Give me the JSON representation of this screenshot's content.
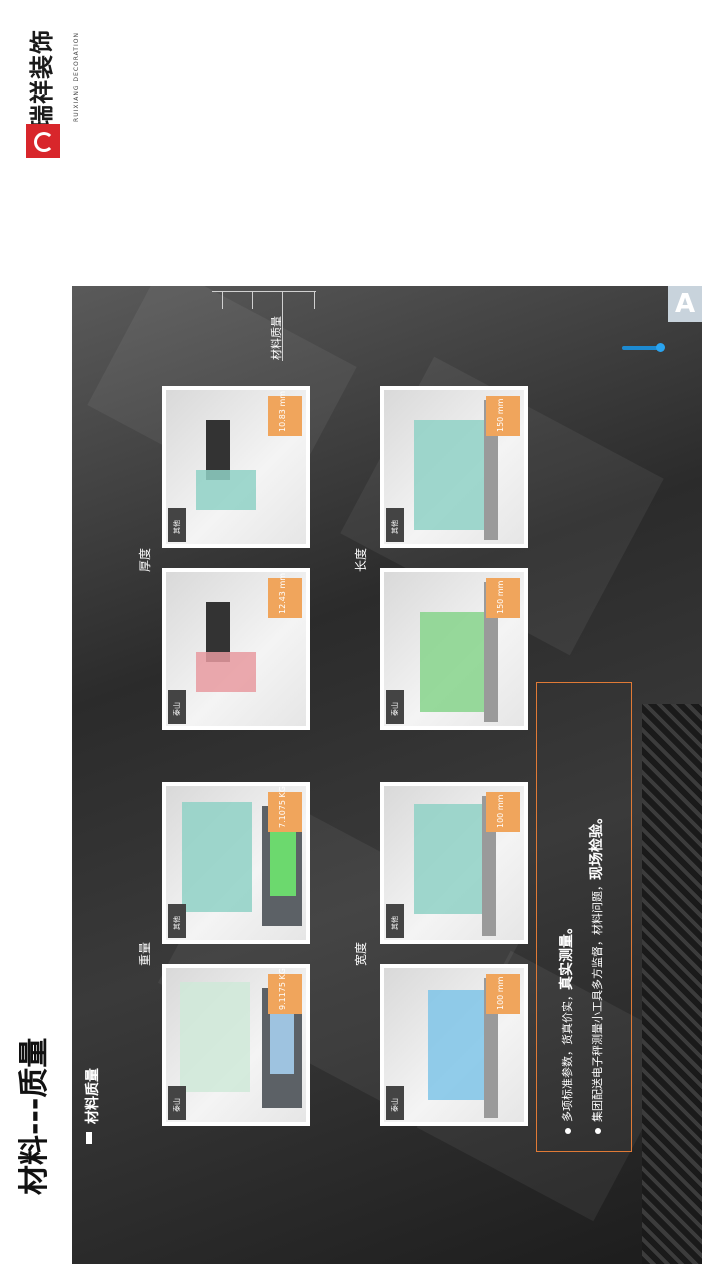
{
  "logo": {
    "name": "瑞祥装饰",
    "sub": "RUIXIANG DECORATION"
  },
  "page_title": "材料---质量",
  "section_title": "材料质量",
  "side_label": "材料质量",
  "badge": "A",
  "categories": {
    "weight": "重量",
    "thickness": "厚度",
    "width": "宽度",
    "length": "长度"
  },
  "cards": [
    {
      "tag": "泰山",
      "measure": "9.1175 KG"
    },
    {
      "tag": "其他",
      "measure": "7.1075 KG"
    },
    {
      "tag": "泰山",
      "measure": "12.43 mm"
    },
    {
      "tag": "其他",
      "measure": "10.83 mm"
    },
    {
      "tag": "泰山",
      "measure": "100 mm"
    },
    {
      "tag": "其他",
      "measure": "100 mm"
    },
    {
      "tag": "泰山",
      "measure": "150 mm"
    },
    {
      "tag": "其他",
      "measure": "150 mm"
    }
  ],
  "notes": {
    "line1_prefix": "多项标准参数，货真价实，",
    "line1_bold": "真实测量。",
    "line2_prefix": "集团配送电子秤测量小工具多方监督，材料问题，",
    "line2_bold": "现场检验。"
  }
}
